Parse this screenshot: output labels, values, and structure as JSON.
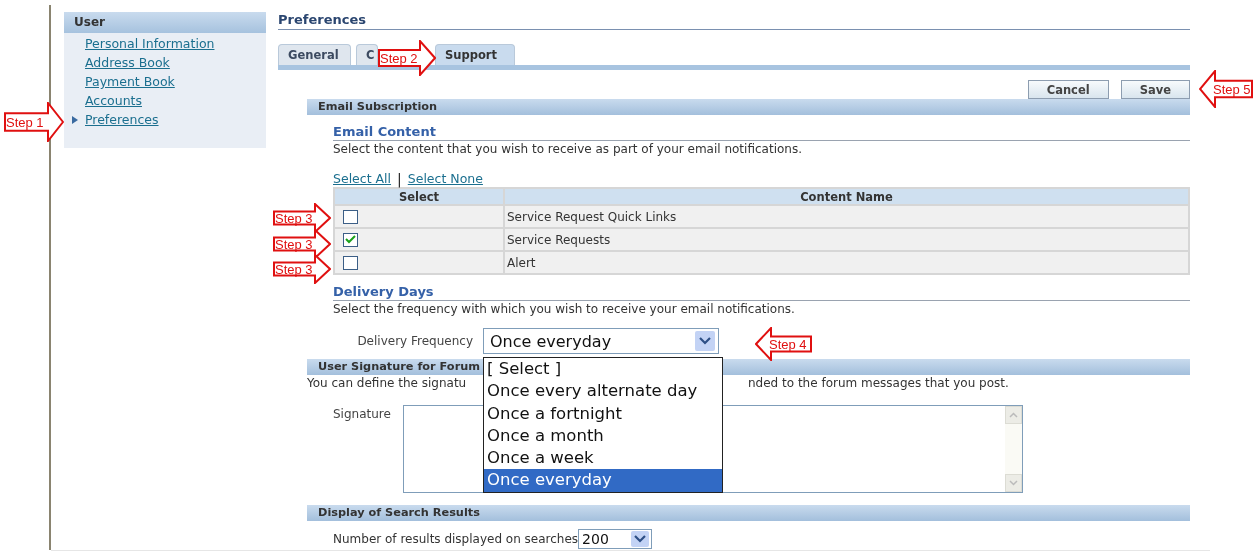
{
  "sidebar": {
    "title": "User",
    "items": [
      {
        "label": "Personal Information",
        "selected": false
      },
      {
        "label": "Address Book",
        "selected": false
      },
      {
        "label": "Payment Book",
        "selected": false
      },
      {
        "label": "Accounts",
        "selected": false
      },
      {
        "label": "Preferences",
        "selected": true
      }
    ]
  },
  "page_title": "Preferences",
  "tabs": [
    {
      "label": "General",
      "selected": false
    },
    {
      "label": "C",
      "selected": false
    },
    {
      "label": "Support",
      "selected": true
    }
  ],
  "actions": [
    "Cancel",
    "Save"
  ],
  "email_subscription": {
    "title": "Email Subscription",
    "content": {
      "title": "Email Content",
      "description": "Select the content that you wish to receive as part of your email notifications.",
      "select_all": "Select All",
      "separator": "|",
      "select_none": "Select None",
      "columns": [
        "Select",
        "Content Name"
      ],
      "rows": [
        {
          "name": "Service Request Quick Links",
          "checked": false
        },
        {
          "name": "Service Requests",
          "checked": true
        },
        {
          "name": "Alert",
          "checked": false
        }
      ]
    },
    "delivery": {
      "title": "Delivery Days",
      "description": "Select the frequency with which you wish to receive your email notifications.",
      "label": "Delivery Frequency",
      "value": "Once everyday",
      "expanded": true,
      "options": [
        {
          "label": "[ Select ]",
          "selected": false
        },
        {
          "label": "Once every alternate day",
          "selected": false
        },
        {
          "label": "Once a fortnight",
          "selected": false
        },
        {
          "label": "Once a month",
          "selected": false
        },
        {
          "label": "Once a week",
          "selected": false
        },
        {
          "label": "Once everyday",
          "selected": true
        }
      ]
    }
  },
  "signature": {
    "title": "User Signature for Forum",
    "description_start": "You can define the signatu",
    "description_end": "nded to the forum messages that you post.",
    "label": "Signature"
  },
  "search_results": {
    "title": "Display of Search Results",
    "label": "Number of results displayed on searches",
    "value": "200"
  },
  "annotations": [
    {
      "label": "Step 1",
      "points_left": false
    },
    {
      "label": "Step 2",
      "points_left": false
    },
    {
      "label": "Step 3",
      "points_left": false
    },
    {
      "label": "Step 3",
      "points_left": false
    },
    {
      "label": "Step 3",
      "points_left": false
    },
    {
      "label": "Step 4",
      "points_left": true
    },
    {
      "label": "Step 5",
      "points_left": true
    }
  ]
}
